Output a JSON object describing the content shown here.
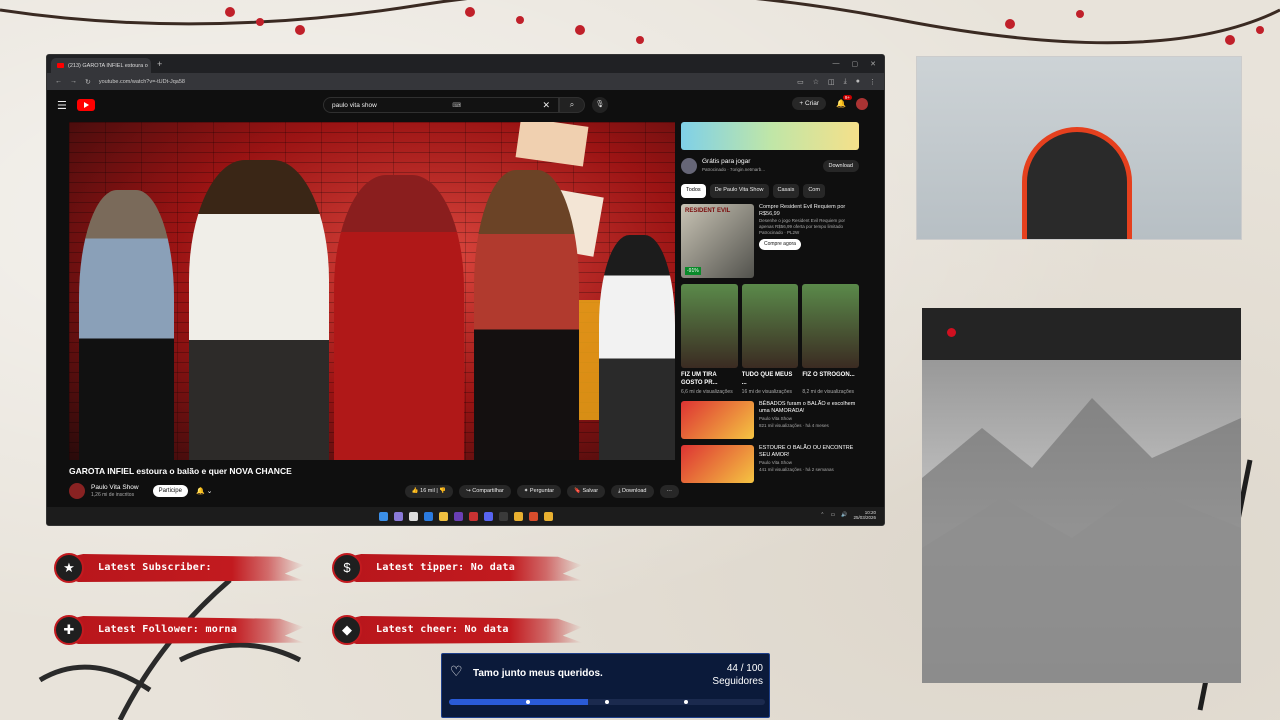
{
  "browser": {
    "tab_title": "(213) GAROTA INFIEL estoura o",
    "url": "youtube.com/watch?v=-tUDt-Jqa58"
  },
  "youtube": {
    "search_query": "paulo vita show",
    "create_label": "Criar",
    "notification_count": "9+",
    "video_title": "GAROTA INFIEL estoura o balão e quer NOVA CHANCE",
    "channel_name": "Paulo Vita Show",
    "channel_subs": "1,26 mi de inscritos",
    "join_label": "Participe",
    "actions": {
      "likes": "16 mil",
      "share": "Compartilhar",
      "ask": "Perguntar",
      "save": "Salvar",
      "download": "Download"
    },
    "sidebar": {
      "ad_title": "Grátis para jogar",
      "ad_sponsor": "Patrocinado · 7origin.netmarb...",
      "ad_button": "Download",
      "chips": [
        "Todos",
        "De Paulo Vita Show",
        "Casais",
        "Com"
      ],
      "rec_ad": {
        "title": "Compre Resident Evil Requiem por R$56,99",
        "desc": "Desenhe o jogo Resident Evil Requiem por apenas R$56,99 oferta por tempo limitado",
        "sponsor": "Patrocinado · PL2W",
        "discount": "-91%",
        "cta": "Compre agora",
        "thumb_text": "RESIDENT EVIL"
      },
      "shorts": [
        {
          "title": "FIZ UM TIRA GOSTO PR...",
          "views": "6,6 mi de visualizações"
        },
        {
          "title": "TUDO QUE MEUS ...",
          "views": "16 mi de visualizações"
        },
        {
          "title": "FIZ O STROGON...",
          "views": "8,2 mi de visualizações"
        }
      ],
      "videos": [
        {
          "title": "BÊBADOS furam o BALÃO e escolhem uma NAMORADA!",
          "channel": "Paulo Vita Show",
          "meta": "821 mil visualizações · há 4 meses"
        },
        {
          "title": "ESTOURE O BALÃO OU ENCONTRE SEU AMOR!",
          "channel": "Paulo Vita Show",
          "meta": "441 mil visualizações · há 2 semanas"
        }
      ]
    }
  },
  "taskbar": {
    "time": "10:20",
    "date": "25/03/2026"
  },
  "alerts": {
    "subscriber": "Latest Subscriber:",
    "tipper": "Latest tipper: No data",
    "follower": "Latest Follower: morna",
    "cheer": "Latest cheer: No data"
  },
  "goal": {
    "title": "Tamo junto meus queridos.",
    "count": "44 / 100",
    "unit": "Seguidores",
    "progress_fraction": 0.44
  }
}
